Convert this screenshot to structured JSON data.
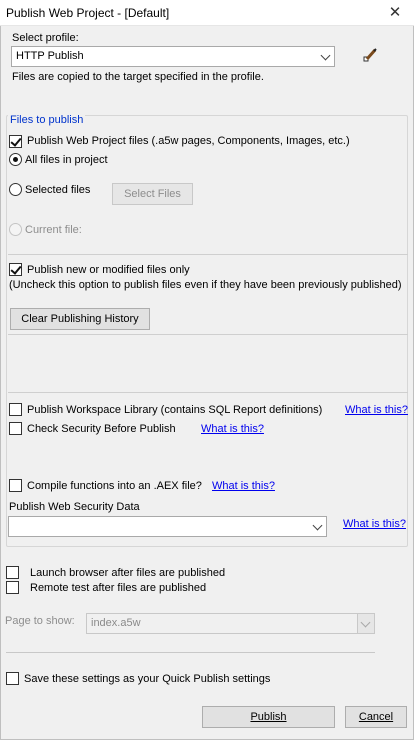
{
  "window": {
    "title": "Publish Web Project - [Default]",
    "close_glyph": "✕"
  },
  "profile": {
    "label": "Select profile:",
    "value": "HTTP Publish",
    "description": "Files are copied to the target specified in the profile.",
    "edit_icon": "edit-pencil-icon"
  },
  "files": {
    "group_label": "Files to publish",
    "publish_project_files": {
      "label": "Publish Web Project files (.a5w pages, Components, Images, etc.)",
      "checked": true
    },
    "all_files": {
      "label": "All files in project",
      "selected": true
    },
    "selected_files": {
      "label": "Selected files",
      "button": "Select Files"
    },
    "current_file": {
      "label": "Current file:"
    },
    "publish_modified": {
      "label": "Publish new or modified files only",
      "checked": true,
      "note": "(Uncheck this option to publish files even if they have been previously published)"
    },
    "clear_history_button": "Clear Publishing History",
    "workspace_library": {
      "label": "Publish Workspace Library (contains SQL Report definitions)",
      "help": "What is this?"
    },
    "check_security": {
      "label": "Check Security Before Publish",
      "help": "What is this?"
    },
    "compile_functions": {
      "label": "Compile functions into an .AEX file?",
      "help": "What is this?"
    },
    "security_data": {
      "label": "Publish Web Security Data",
      "value": "",
      "help": "What is this?"
    }
  },
  "launch_browser": {
    "label": "Launch browser after files are published"
  },
  "remote_test": {
    "label": "Remote test after files are published"
  },
  "page_to_show": {
    "label": "Page to show:",
    "value": "index.a5w"
  },
  "quick_publish": {
    "label": "Save these settings as your Quick Publish settings"
  },
  "buttons": {
    "publish": "Publish",
    "cancel": "Cancel"
  }
}
